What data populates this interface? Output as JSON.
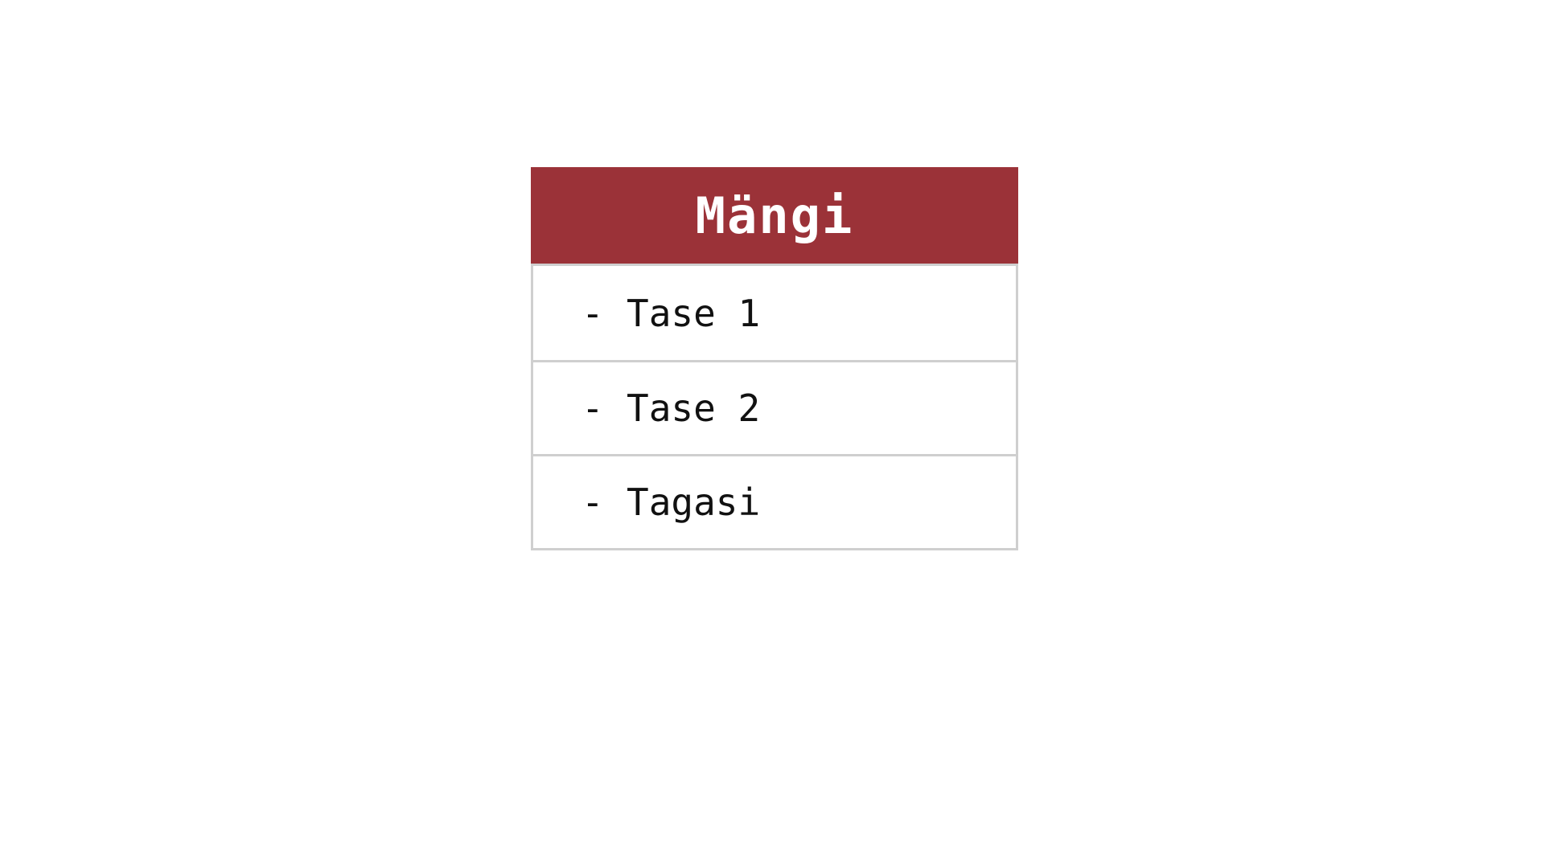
{
  "menu": {
    "title": "Mängi",
    "items": [
      {
        "prefix": "-",
        "label": "Tase 1"
      },
      {
        "prefix": "-",
        "label": "Tase 2"
      },
      {
        "prefix": "-",
        "label": "Tagasi"
      }
    ]
  },
  "colors": {
    "header_bg": "#9b3238",
    "header_text": "#ffffff",
    "border": "#cfcfcf"
  }
}
